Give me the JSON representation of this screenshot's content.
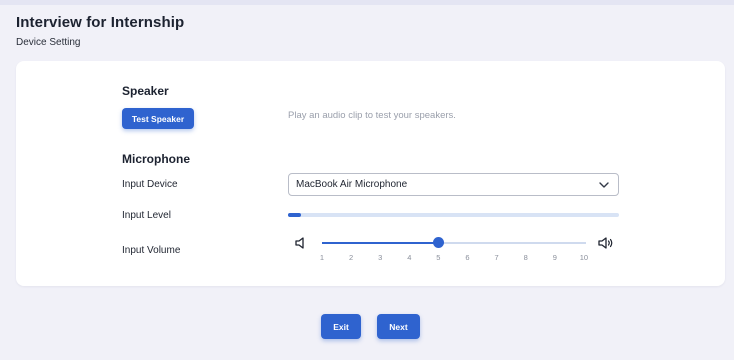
{
  "header": {
    "title": "Interview for Internship",
    "subtitle": "Device Setting"
  },
  "speaker": {
    "section_title": "Speaker",
    "test_button_label": "Test Speaker",
    "helper_text": "Play an audio clip to test your speakers."
  },
  "microphone": {
    "section_title": "Microphone",
    "input_device": {
      "label": "Input Device",
      "selected": "MacBook Air Microphone"
    },
    "input_level": {
      "label": "Input Level",
      "level_fraction": 0.04
    },
    "input_volume": {
      "label": "Input Volume",
      "value": 5,
      "min": 1,
      "max": 10,
      "ticks": [
        "1",
        "2",
        "3",
        "4",
        "5",
        "6",
        "7",
        "8",
        "9",
        "10"
      ]
    }
  },
  "footer": {
    "exit_label": "Exit",
    "next_label": "Next"
  },
  "colors": {
    "accent": "#2f63cf",
    "track": "#d8e3f5",
    "background": "#f1f1f8",
    "card": "#ffffff"
  },
  "icons": {
    "dropdown": "chevron-down-icon",
    "volume_low": "speaker-mute-icon",
    "volume_high": "speaker-loud-icon"
  }
}
